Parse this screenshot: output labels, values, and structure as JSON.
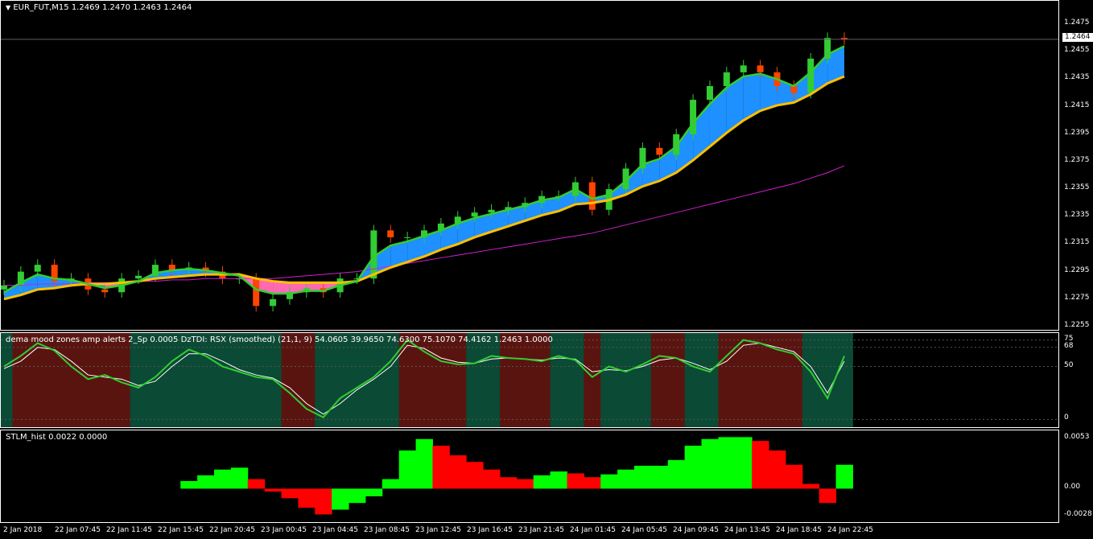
{
  "main": {
    "title": "EUR_FUT,M15  1.2469 1.2470 1.2463 1.2464",
    "current_price_label": "1.2464",
    "current_price": 1.2464,
    "price_axis": [
      "1.2475",
      "1.2455",
      "1.2435",
      "1.2415",
      "1.2395",
      "1.2375",
      "1.2355",
      "1.2335",
      "1.2315",
      "1.2295",
      "1.2275",
      "1.2255"
    ]
  },
  "tdi": {
    "title": "dema mood zones amp alerts 2_Sp 0.0005  DzTDI:  RSX (smoothed) (21,1, 9) 54.0605 39.9650 74.6300 75.1070 74.4162 1.2463 1.0000",
    "levels": [
      "75",
      "68",
      "50",
      "0"
    ]
  },
  "hist": {
    "title": "STLM_hist 0.0022 0.0000",
    "levels": [
      "0.0053",
      "0.00",
      "-0.0028"
    ]
  },
  "time_axis": [
    "2 Jan 2018",
    "22 Jan 07:45",
    "22 Jan 11:45",
    "22 Jan 15:45",
    "22 Jan 20:45",
    "23 Jan 00:45",
    "23 Jan 04:45",
    "23 Jan 08:45",
    "23 Jan 12:45",
    "23 Jan 16:45",
    "23 Jan 21:45",
    "24 Jan 01:45",
    "24 Jan 05:45",
    "24 Jan 09:45",
    "24 Jan 13:45",
    "24 Jan 18:45",
    "24 Jan 22:45"
  ],
  "colors": {
    "background": "#000000",
    "bull_candle": "#32cd32",
    "bear_candle": "#ff4500",
    "cloud_bull": "#1e90ff",
    "cloud_bear": "#ff69b4",
    "ema_fast": "#32cd32",
    "ema_slow": "#ffc000",
    "ma_long": "#d020d0",
    "zone_green": "#0b4a34",
    "zone_red": "#5a1410",
    "hist_up": "#00ff00",
    "hist_down": "#ff0000"
  },
  "chart_data": [
    {
      "type": "line",
      "name": "EUR_FUT M15 price",
      "ylim": [
        1.2255,
        1.2485
      ],
      "x_index": [
        0,
        2,
        4,
        6,
        8,
        10,
        12,
        14,
        16,
        18,
        20,
        22,
        24,
        26,
        28,
        30,
        32,
        34,
        36,
        38,
        40,
        42,
        44,
        46,
        48,
        50,
        52,
        54,
        56,
        58,
        60,
        62,
        64,
        66,
        68,
        70,
        72,
        74,
        76,
        78,
        80,
        82,
        84,
        86,
        88,
        90,
        92,
        94,
        96,
        98,
        100
      ],
      "close": [
        1.2285,
        1.2295,
        1.23,
        1.2288,
        1.229,
        1.2282,
        1.228,
        1.229,
        1.2292,
        1.23,
        1.2296,
        1.2298,
        1.2295,
        1.229,
        1.229,
        1.227,
        1.2275,
        1.228,
        1.2283,
        1.228,
        1.229,
        1.229,
        1.2325,
        1.232,
        1.232,
        1.2325,
        1.233,
        1.2335,
        1.2338,
        1.234,
        1.2342,
        1.2345,
        1.235,
        1.235,
        1.236,
        1.234,
        1.2355,
        1.237,
        1.2385,
        1.238,
        1.2395,
        1.242,
        1.243,
        1.244,
        1.2445,
        1.244,
        1.243,
        1.2425,
        1.245,
        1.2465,
        1.2464
      ],
      "ema_fast": [
        1.228,
        1.2287,
        1.2293,
        1.229,
        1.2289,
        1.2286,
        1.2283,
        1.2285,
        1.2288,
        1.2294,
        1.2296,
        1.2297,
        1.2296,
        1.2294,
        1.2292,
        1.2282,
        1.2279,
        1.2279,
        1.2281,
        1.2281,
        1.2285,
        1.2288,
        1.2306,
        1.2314,
        1.2317,
        1.2321,
        1.2325,
        1.233,
        1.2334,
        1.2337,
        1.234,
        1.2343,
        1.2347,
        1.2349,
        1.2355,
        1.2348,
        1.2351,
        1.2361,
        1.2373,
        1.2377,
        1.2386,
        1.2403,
        1.2417,
        1.2429,
        1.2437,
        1.2439,
        1.2435,
        1.243,
        1.244,
        1.2453,
        1.2459
      ],
      "ema_slow": [
        1.2275,
        1.2278,
        1.2282,
        1.2283,
        1.2285,
        1.2286,
        1.2286,
        1.2287,
        1.2288,
        1.229,
        1.2291,
        1.2292,
        1.2293,
        1.2293,
        1.2293,
        1.229,
        1.2288,
        1.2287,
        1.2287,
        1.2287,
        1.2287,
        1.2288,
        1.2293,
        1.2298,
        1.2302,
        1.2306,
        1.2311,
        1.2315,
        1.232,
        1.2324,
        1.2328,
        1.2332,
        1.2336,
        1.2339,
        1.2344,
        1.2345,
        1.2347,
        1.2351,
        1.2357,
        1.2361,
        1.2367,
        1.2376,
        1.2386,
        1.2396,
        1.2405,
        1.2412,
        1.2416,
        1.2418,
        1.2424,
        1.2432,
        1.2437
      ],
      "ma_long": [
        1.2285,
        1.2285,
        1.2286,
        1.2286,
        1.2286,
        1.2287,
        1.2287,
        1.2287,
        1.2288,
        1.2288,
        1.2289,
        1.2289,
        1.229,
        1.229,
        1.229,
        1.229,
        1.229,
        1.2291,
        1.2292,
        1.2293,
        1.2294,
        1.2295,
        1.2297,
        1.2299,
        1.2301,
        1.2303,
        1.2305,
        1.2307,
        1.2309,
        1.2311,
        1.2313,
        1.2315,
        1.2317,
        1.2319,
        1.2321,
        1.2323,
        1.2326,
        1.2329,
        1.2332,
        1.2335,
        1.2338,
        1.2341,
        1.2344,
        1.2347,
        1.235,
        1.2353,
        1.2356,
        1.2359,
        1.2363,
        1.2367,
        1.2372
      ]
    },
    {
      "type": "line",
      "name": "DzTDI RSX smoothed",
      "ylim": [
        -5,
        80
      ],
      "x_index": [
        0,
        2,
        4,
        6,
        8,
        10,
        12,
        14,
        16,
        18,
        20,
        22,
        24,
        26,
        28,
        30,
        32,
        34,
        36,
        38,
        40,
        42,
        44,
        46,
        48,
        50,
        52,
        54,
        56,
        58,
        60,
        62,
        64,
        66,
        68,
        70,
        72,
        74,
        76,
        78,
        80,
        82,
        84,
        86,
        88,
        90,
        92,
        94,
        96,
        98,
        100
      ],
      "rsx": [
        50,
        60,
        72,
        65,
        50,
        38,
        42,
        35,
        30,
        40,
        55,
        66,
        60,
        50,
        45,
        40,
        38,
        25,
        10,
        2,
        20,
        30,
        40,
        55,
        75,
        64,
        55,
        52,
        53,
        60,
        58,
        57,
        55,
        60,
        56,
        40,
        50,
        45,
        52,
        60,
        58,
        50,
        45,
        60,
        75,
        72,
        66,
        62,
        45,
        20,
        60
      ],
      "signal": [
        48,
        55,
        68,
        66,
        55,
        42,
        40,
        38,
        32,
        36,
        50,
        62,
        62,
        55,
        47,
        42,
        39,
        30,
        15,
        5,
        15,
        28,
        38,
        50,
        70,
        67,
        58,
        54,
        53,
        57,
        58,
        57,
        56,
        58,
        57,
        45,
        47,
        46,
        50,
        56,
        58,
        53,
        47,
        55,
        70,
        72,
        68,
        64,
        50,
        25,
        55
      ],
      "zones": [
        "green",
        "red",
        "red",
        "red",
        "red",
        "red",
        "red",
        "red",
        "green",
        "green",
        "green",
        "green",
        "green",
        "green",
        "green",
        "green",
        "green",
        "red",
        "red",
        "green",
        "green",
        "green",
        "green",
        "green",
        "red",
        "red",
        "red",
        "red",
        "green",
        "green",
        "red",
        "red",
        "red",
        "green",
        "green",
        "red",
        "green",
        "green",
        "green",
        "red",
        "red",
        "green",
        "green",
        "red",
        "red",
        "red",
        "red",
        "red",
        "green",
        "green",
        "green"
      ]
    },
    {
      "type": "bar",
      "name": "STLM_hist",
      "ylim": [
        -0.003,
        0.0056
      ],
      "x_index": [
        0,
        2,
        4,
        6,
        8,
        10,
        12,
        14,
        16,
        18,
        20,
        22,
        24,
        26,
        28,
        30,
        32,
        34,
        36,
        38,
        40,
        42,
        44,
        46,
        48,
        50,
        52,
        54,
        56,
        58,
        60,
        62,
        64,
        66,
        68,
        70,
        72,
        74,
        76,
        78,
        80,
        82,
        84,
        86,
        88,
        90,
        92,
        94,
        96,
        98,
        100
      ],
      "values": [
        0,
        0,
        0,
        0,
        0,
        0,
        0,
        0,
        0,
        0,
        0,
        0.0008,
        0.0014,
        0.002,
        0.0022,
        0.001,
        -0.0003,
        -0.001,
        -0.002,
        -0.0027,
        -0.0022,
        -0.0015,
        -0.0008,
        0.001,
        0.004,
        0.0052,
        0.0045,
        0.0035,
        0.0028,
        0.002,
        0.0012,
        0.001,
        0.0014,
        0.0018,
        0.0016,
        0.0012,
        0.0015,
        0.002,
        0.0024,
        0.0024,
        0.003,
        0.0045,
        0.0052,
        0.0054,
        0.0054,
        0.005,
        0.004,
        0.0025,
        0.0005,
        -0.0015,
        0.0025
      ]
    }
  ]
}
